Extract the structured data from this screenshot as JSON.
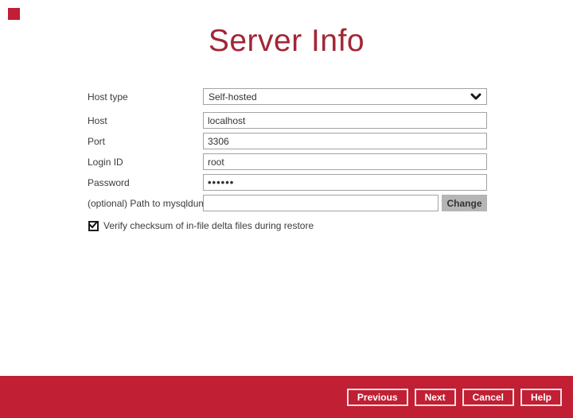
{
  "colors": {
    "accent": "#c11f33",
    "title": "#a22636",
    "text": "#3b3b3b",
    "field-border": "#a3a3a3",
    "field-text": "#333333",
    "change-bg": "#b5b5b5",
    "change-text": "#333333",
    "footer-btn-border": "#f2dfe2",
    "footer-btn-text": "#ffffff"
  },
  "header": {
    "title": "Server Info"
  },
  "form": {
    "host_type": {
      "label": "Host type",
      "value": "Self-hosted"
    },
    "host": {
      "label": "Host",
      "value": "localhost"
    },
    "port": {
      "label": "Port",
      "value": "3306"
    },
    "login_id": {
      "label": "Login ID",
      "value": "root"
    },
    "password": {
      "label": "Password",
      "value": "••••••"
    },
    "mysqldump": {
      "label": "(optional) Path to mysqldump",
      "value": "",
      "button_label": "Change"
    },
    "verify_checkbox": {
      "label": "Verify checksum of in-file delta files during restore",
      "checked": true
    }
  },
  "footer": {
    "buttons": [
      "Previous",
      "Next",
      "Cancel",
      "Help"
    ]
  }
}
